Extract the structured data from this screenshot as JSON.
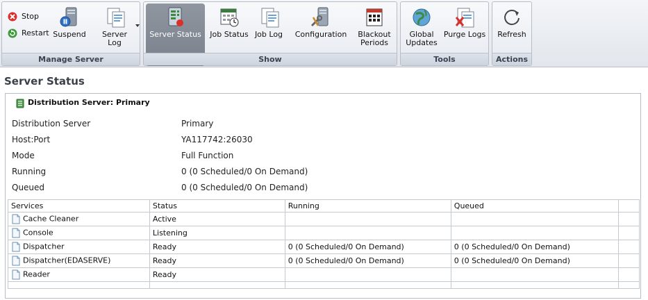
{
  "ribbon": {
    "manage_server": {
      "label": "Manage Server",
      "stop": "Stop",
      "restart": "Restart",
      "suspend": "Suspend",
      "server_log_1": "Server",
      "server_log_2": "Log"
    },
    "show": {
      "label": "Show",
      "server_status": "Server Status",
      "job_status": "Job Status",
      "job_log": "Job Log",
      "configuration": "Configuration",
      "blackout_1": "Blackout",
      "blackout_2": "Periods"
    },
    "tools": {
      "label": "Tools",
      "global_1": "Global",
      "global_2": "Updates",
      "purge_logs": "Purge Logs"
    },
    "actions": {
      "label": "Actions",
      "refresh": "Refresh"
    }
  },
  "page": {
    "title": "Server Status",
    "panel_heading": "Distribution Server: Primary",
    "fields": [
      {
        "label": "Distribution Server",
        "value": "Primary"
      },
      {
        "label": "Host:Port",
        "value": "YA117742:26030"
      },
      {
        "label": "Mode",
        "value": "Full Function"
      },
      {
        "label": "Running",
        "value": "0 (0 Scheduled/0 On Demand)"
      },
      {
        "label": "Queued",
        "value": "0 (0 Scheduled/0 On Demand)"
      }
    ]
  },
  "services_table": {
    "headers": [
      "Services",
      "Status",
      "Running",
      "Queued"
    ],
    "rows": [
      {
        "service": "Cache Cleaner",
        "status": "Active",
        "running": "",
        "queued": ""
      },
      {
        "service": "Console",
        "status": "Listening",
        "running": "",
        "queued": ""
      },
      {
        "service": "Dispatcher",
        "status": "Ready",
        "running": "0 (0 Scheduled/0 On Demand)",
        "queued": "0 (0 Scheduled/0 On Demand)"
      },
      {
        "service": "Dispatcher(EDASERVE)",
        "status": "Ready",
        "running": "0 (0 Scheduled/0 On Demand)",
        "queued": "0 (0 Scheduled/0 On Demand)"
      },
      {
        "service": "Reader",
        "status": "Ready",
        "running": "",
        "queued": ""
      }
    ]
  }
}
